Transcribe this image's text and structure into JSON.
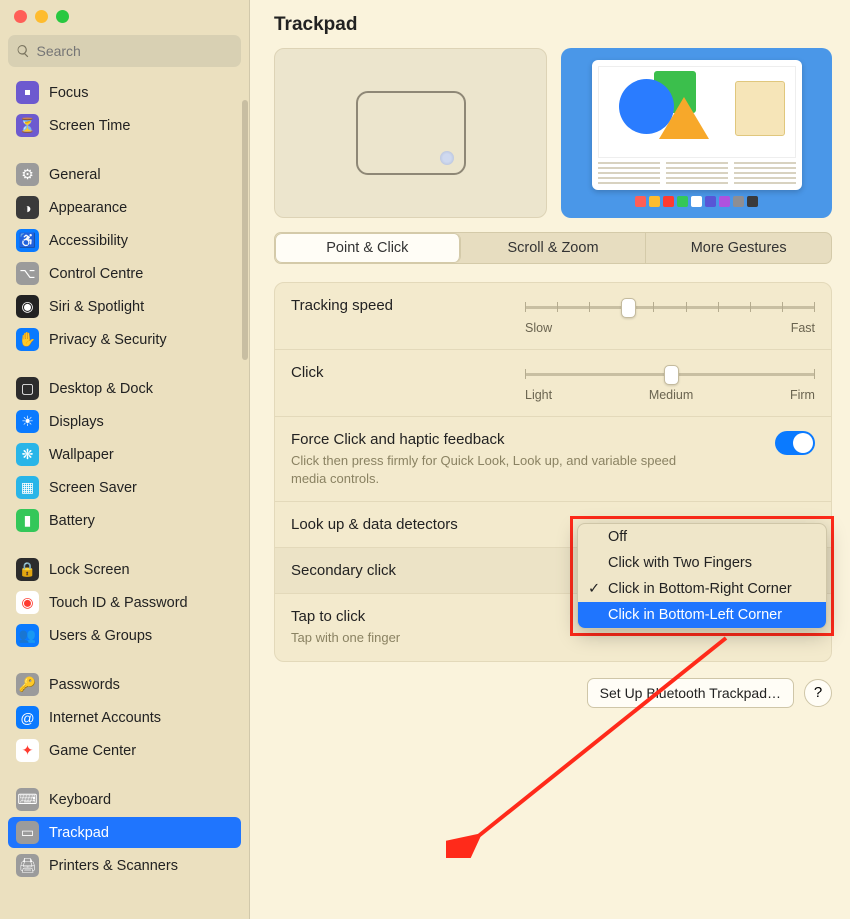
{
  "search_placeholder": "Search",
  "title": "Trackpad",
  "sidebar": {
    "groups": [
      [
        {
          "label": "Focus",
          "icon": "￭",
          "bg": "#6d5acf"
        },
        {
          "label": "Screen Time",
          "icon": "⏳",
          "bg": "#6d5acf"
        }
      ],
      [
        {
          "label": "General",
          "icon": "⚙",
          "bg": "#9b9b9b"
        },
        {
          "label": "Appearance",
          "icon": "◑",
          "bg": "#3a3a3a"
        },
        {
          "label": "Accessibility",
          "icon": "♿",
          "bg": "#0a7aff"
        },
        {
          "label": "Control Centre",
          "icon": "⌥",
          "bg": "#9b9b9b"
        },
        {
          "label": "Siri & Spotlight",
          "icon": "◉",
          "bg": "#222"
        },
        {
          "label": "Privacy & Security",
          "icon": "✋",
          "bg": "#0a7aff"
        }
      ],
      [
        {
          "label": "Desktop & Dock",
          "icon": "▢",
          "bg": "#2c2c2c"
        },
        {
          "label": "Displays",
          "icon": "☀",
          "bg": "#0a7aff"
        },
        {
          "label": "Wallpaper",
          "icon": "❋",
          "bg": "#29b5e8"
        },
        {
          "label": "Screen Saver",
          "icon": "▦",
          "bg": "#29b5e8"
        },
        {
          "label": "Battery",
          "icon": "▮",
          "bg": "#34c759"
        }
      ],
      [
        {
          "label": "Lock Screen",
          "icon": "🔒",
          "bg": "#2c2c2c"
        },
        {
          "label": "Touch ID & Password",
          "icon": "◉",
          "bg": "#fff",
          "fg": "#ff3b30"
        },
        {
          "label": "Users & Groups",
          "icon": "👥",
          "bg": "#0a7aff"
        }
      ],
      [
        {
          "label": "Passwords",
          "icon": "🔑",
          "bg": "#9b9b9b"
        },
        {
          "label": "Internet Accounts",
          "icon": "@",
          "bg": "#0a7aff"
        },
        {
          "label": "Game Center",
          "icon": "✦",
          "bg": "#fff",
          "fg": "#ff3b30"
        }
      ],
      [
        {
          "label": "Keyboard",
          "icon": "⌨",
          "bg": "#9b9b9b"
        },
        {
          "label": "Trackpad",
          "icon": "▭",
          "bg": "#9b9b9b",
          "selected": true
        },
        {
          "label": "Printers & Scanners",
          "icon": "🖨",
          "bg": "#9b9b9b"
        }
      ]
    ]
  },
  "tabs": [
    "Point & Click",
    "Scroll & Zoom",
    "More Gestures"
  ],
  "active_tab": 0,
  "rows": {
    "tracking": {
      "label": "Tracking speed",
      "min": "Slow",
      "max": "Fast"
    },
    "click": {
      "label": "Click",
      "min": "Light",
      "mid": "Medium",
      "max": "Firm"
    },
    "force": {
      "label": "Force Click and haptic feedback",
      "sub": "Click then press firmly for Quick Look, Look up, and variable speed media controls."
    },
    "lookup": {
      "label": "Look up & data detectors"
    },
    "secondary": {
      "label": "Secondary click"
    },
    "tap": {
      "label": "Tap to click",
      "sub": "Tap with one finger"
    }
  },
  "popup": {
    "options": [
      "Off",
      "Click with Two Fingers",
      "Click in Bottom-Right Corner",
      "Click in Bottom-Left Corner"
    ],
    "checked": 2,
    "highlighted": 3
  },
  "footer": {
    "setup": "Set Up Bluetooth Trackpad…",
    "help": "?"
  },
  "dock_colors": [
    "#ff5f57",
    "#febc2e",
    "#ff3b30",
    "#34c759",
    "#ffffff",
    "#5856d6",
    "#af52de",
    "#8e8e93",
    "#3a3a3c"
  ]
}
